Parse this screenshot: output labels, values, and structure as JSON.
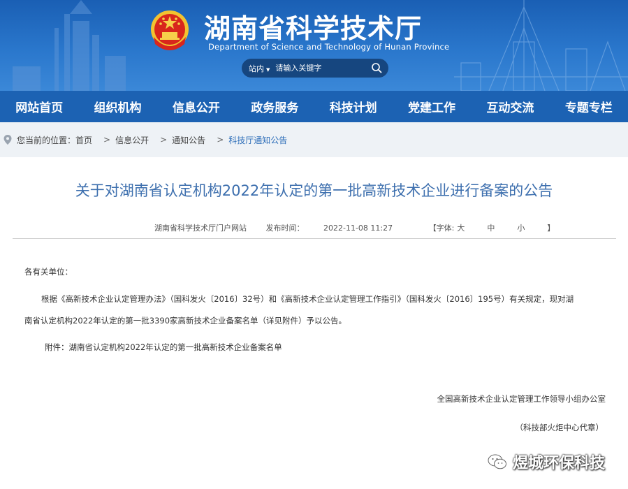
{
  "header": {
    "title": "湖南省科学技术厅",
    "subtitle": "Department of Science and Technology of Hunan Province",
    "search": {
      "scope": "站内",
      "placeholder": "请输入关键字"
    },
    "colors": {
      "banner": "#1a5fb4",
      "nav": "#1c62b3",
      "search_box": "#16467f"
    }
  },
  "nav": {
    "items": [
      "网站首页",
      "组织机构",
      "信息公开",
      "政务服务",
      "科技计划",
      "党建工作",
      "互动交流",
      "专题专栏"
    ]
  },
  "breadcrumb": {
    "prefix": "您当前的位置：",
    "items": [
      "首页",
      "信息公开",
      "通知公告",
      "科技厅通知公告"
    ],
    "separator": ">"
  },
  "article": {
    "title": "关于对湖南省认定机构2022年认定的第一批高新技术企业进行备案的公告",
    "meta": {
      "source": "湖南省科学技术厅门户网站",
      "published_label": "发布时间：",
      "published": "2022-11-08 11:27",
      "font_label": "【字体:",
      "font_large": "大",
      "font_medium": "中",
      "font_small": "小",
      "font_close": "】"
    },
    "greeting": "各有关单位：",
    "para1_line1": "根据《高新技术企业认定管理办法》（国科发火〔2016〕32号）和《高新技术企业认定管理工作指引》（国科发火〔2016〕195号）有关规定，现对湖",
    "para1_line2": "南省认定机构2022年认定的第一批3390家高新技术企业备案名单（详见附件）予以公告。",
    "attachment": "附件：湖南省认定机构2022年认定的第一批高新技术企业备案名单",
    "signature": "全国高新技术企业认定管理工作领导小组办公室",
    "signature_note": "（科技部火炬中心代章）"
  },
  "watermark": {
    "text": "煜城环保科技",
    "icon": "wechat-icon"
  }
}
